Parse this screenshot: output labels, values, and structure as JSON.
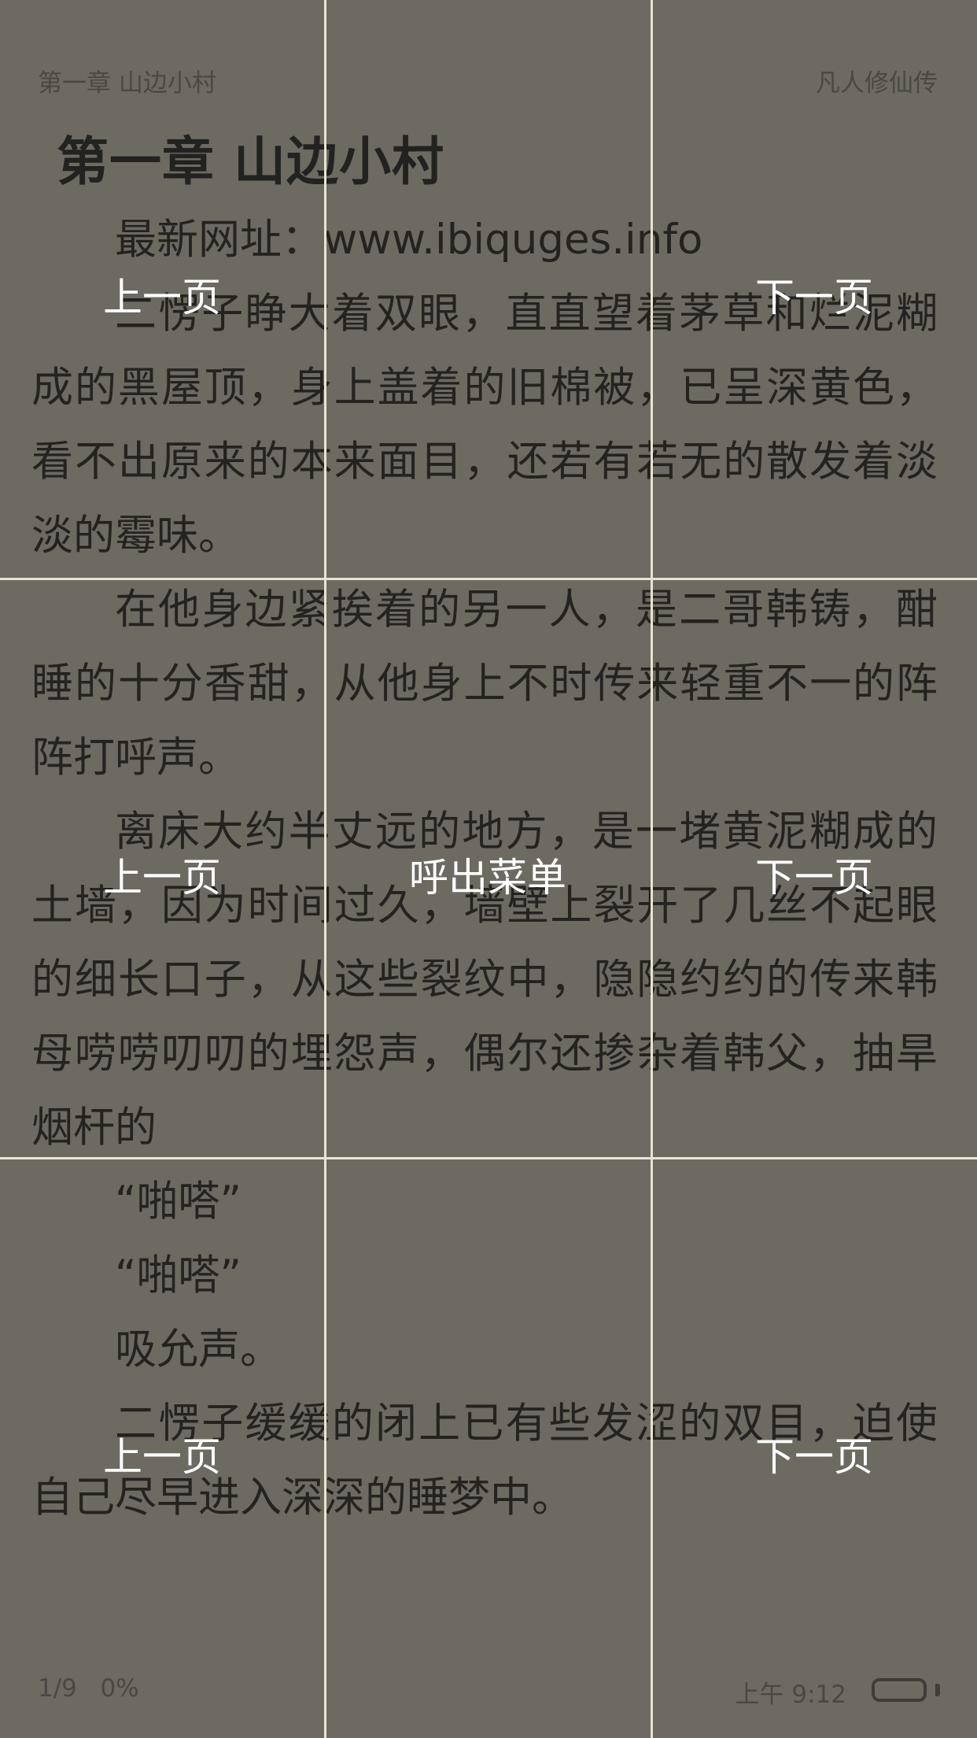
{
  "header": {
    "chapter": "第一章 山边小村",
    "book": "凡人修仙传"
  },
  "chapter_title": "第一章 山边小村",
  "paragraphs": [
    "最新网址：www.ibiquges.info",
    "二愣子睁大着双眼，直直望着茅草和烂泥糊成的黑屋顶，身上盖着的旧棉被，已呈深黄色，看不出原来的本来面目，还若有若无的散发着淡淡的霉味。",
    "在他身边紧挨着的另一人，是二哥韩铸，酣睡的十分香甜，从他身上不时传来轻重不一的阵阵打呼声。",
    "离床大约半丈远的地方，是一堵黄泥糊成的土墙，因为时间过久，墙壁上裂开了几丝不起眼的细长口子，从这些裂纹中，隐隐约约的传来韩母唠唠叨叨的埋怨声，偶尔还掺杂着韩父，抽旱烟杆的",
    "“啪嗒”",
    "“啪嗒”",
    "吸允声。",
    "二愣子缓缓的闭上已有些发涩的双目，迫使自己尽早进入深深的睡梦中。"
  ],
  "footer": {
    "page": "1/9",
    "progress": "0%",
    "time": "上午 9:12"
  },
  "zones": {
    "prev": "上一页",
    "next": "下一页",
    "menu": "呼出菜单"
  },
  "colors": {
    "background": "#6d6a62",
    "text": "#24231f",
    "overlay_line": "#e8e4d4"
  }
}
